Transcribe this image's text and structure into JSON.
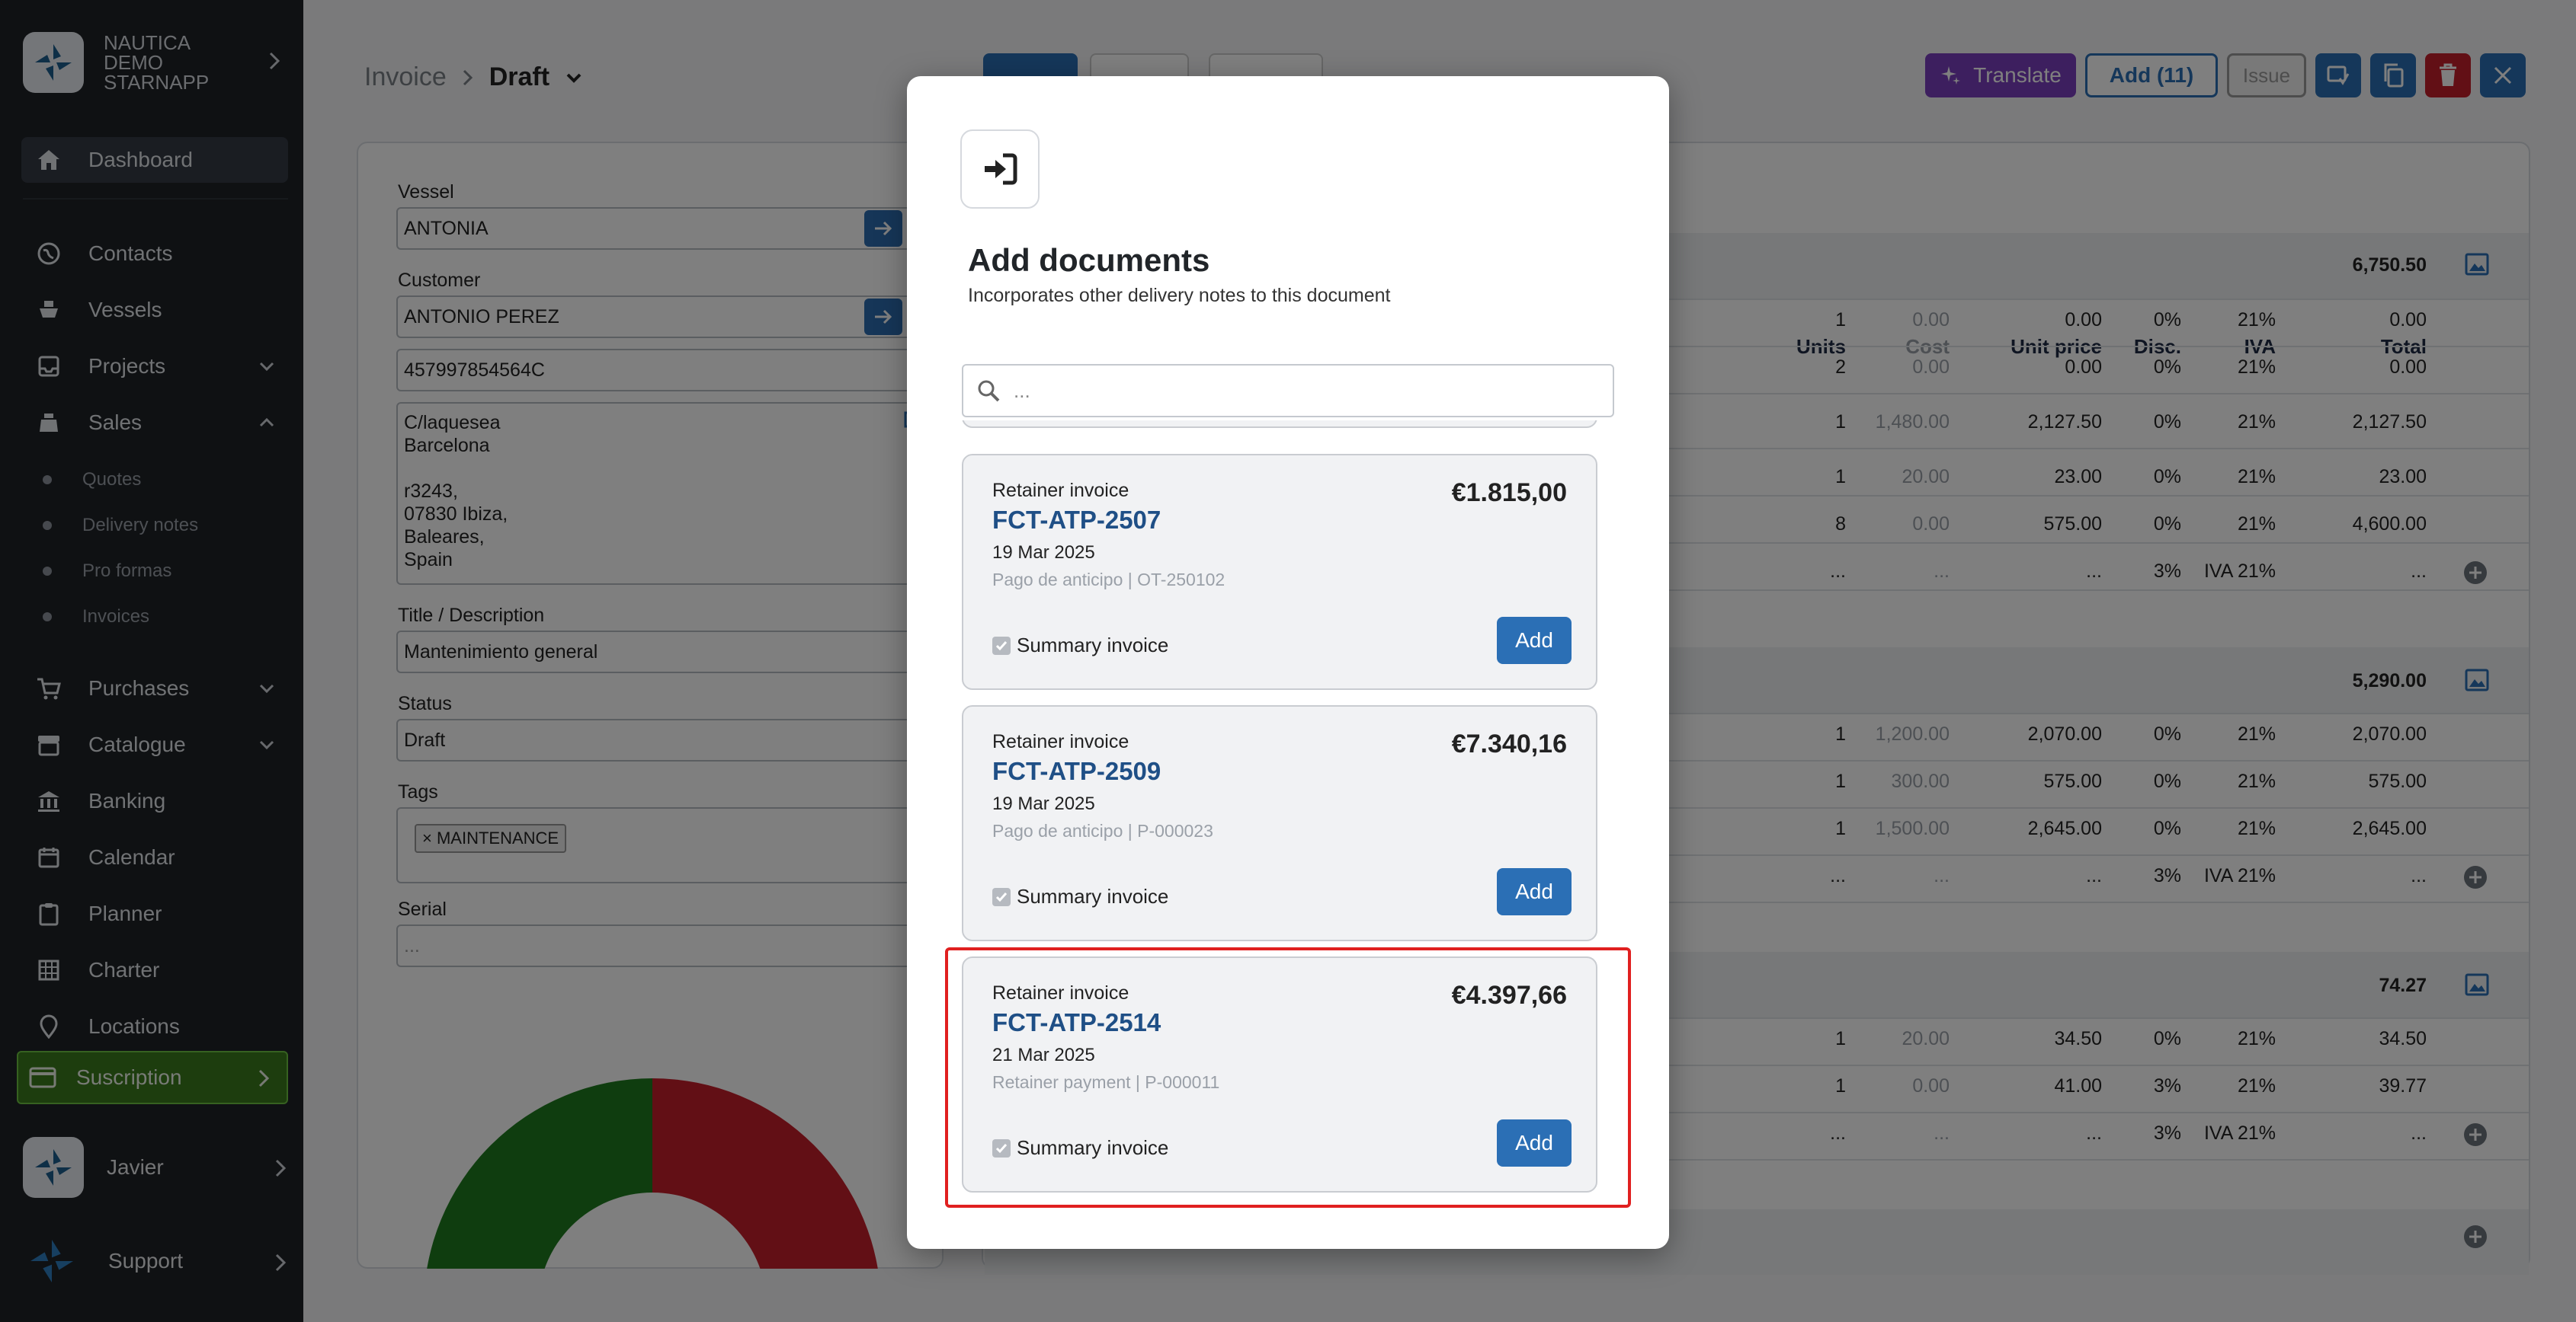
{
  "sidebar": {
    "org_name": "NAUTICA DEMO STARNAPP",
    "items": [
      {
        "label": "Dashboard",
        "icon": "home-icon"
      },
      {
        "label": "Contacts",
        "icon": "globe-icon"
      },
      {
        "label": "Vessels",
        "icon": "ship-icon"
      },
      {
        "label": "Projects",
        "icon": "inbox-icon"
      },
      {
        "label": "Sales",
        "icon": "cash-register-icon"
      },
      {
        "label": "Purchases",
        "icon": "cart-icon"
      },
      {
        "label": "Catalogue",
        "icon": "archive-icon"
      },
      {
        "label": "Banking",
        "icon": "bank-icon"
      },
      {
        "label": "Calendar",
        "icon": "calendar-icon"
      },
      {
        "label": "Planner",
        "icon": "clipboard-icon"
      },
      {
        "label": "Charter",
        "icon": "grid-icon"
      },
      {
        "label": "Locations",
        "icon": "location-icon"
      }
    ],
    "sales_sub": [
      "Quotes",
      "Delivery notes",
      "Pro formas",
      "Invoices"
    ],
    "subscription": "Suscription",
    "user": "Javier",
    "support": "Support"
  },
  "header": {
    "breadcrumb": [
      "Invoice",
      "Draft"
    ],
    "translate": "Translate",
    "add": "Add (11)",
    "issue": "Issue"
  },
  "form": {
    "vessel_label": "Vessel",
    "vessel": "ANTONIA",
    "customer_label": "Customer",
    "customer": "ANTONIO PEREZ",
    "tax_id": "457997854564C",
    "address": [
      "C/laquesea",
      "Barcelona",
      "",
      "r3243,",
      "07830 Ibiza,",
      "Baleares,",
      "Spain"
    ],
    "title_label": "Title / Description",
    "title": "Mantenimiento general",
    "status_label": "Status",
    "status": "Draft",
    "tags_label": "Tags",
    "tag": "MAINTENANCE",
    "serial_label": "Serial",
    "serial": "..."
  },
  "table": {
    "headers": [
      "Units",
      "Cost",
      "Unit price",
      "Disc.",
      "IVA",
      "Total"
    ],
    "group_totals": [
      "6,750.50",
      "5,290.00",
      "74.27"
    ],
    "rows": [
      [
        "1",
        "0.00",
        "0.00",
        "0%",
        "21%",
        "0.00"
      ],
      [
        "2",
        "0.00",
        "0.00",
        "0%",
        "21%",
        "0.00"
      ],
      [
        "1",
        "1,480.00",
        "2,127.50",
        "0%",
        "21%",
        "2,127.50"
      ],
      [
        "1",
        "20.00",
        "23.00",
        "0%",
        "21%",
        "23.00"
      ],
      [
        "8",
        "0.00",
        "575.00",
        "0%",
        "21%",
        "4,600.00"
      ],
      [
        "...",
        "...",
        "...",
        "3%",
        "IVA 21%",
        "..."
      ],
      [
        "1",
        "1,200.00",
        "2,070.00",
        "0%",
        "21%",
        "2,070.00"
      ],
      [
        "1",
        "300.00",
        "575.00",
        "0%",
        "21%",
        "575.00"
      ],
      [
        "1",
        "1,500.00",
        "2,645.00",
        "0%",
        "21%",
        "2,645.00"
      ],
      [
        "...",
        "...",
        "...",
        "3%",
        "IVA 21%",
        "..."
      ],
      [
        "1",
        "20.00",
        "34.50",
        "0%",
        "21%",
        "34.50"
      ],
      [
        "1",
        "0.00",
        "41.00",
        "3%",
        "21%",
        "39.77"
      ],
      [
        "...",
        "...",
        "...",
        "3%",
        "IVA 21%",
        "..."
      ]
    ]
  },
  "modal": {
    "title": "Add documents",
    "subtitle": "Incorporates other delivery notes to this document",
    "search_placeholder": "...",
    "documents": [
      {
        "type": "Retainer invoice",
        "number": "FCT-ATP-2507",
        "amount": "€1.815,00",
        "date": "19 Mar 2025",
        "ref": "Pago de anticipo | OT-250102",
        "summary": "Summary invoice",
        "add": "Add"
      },
      {
        "type": "Retainer invoice",
        "number": "FCT-ATP-2509",
        "amount": "€7.340,16",
        "date": "19 Mar 2025",
        "ref": "Pago de anticipo | P-000023",
        "summary": "Summary invoice",
        "add": "Add"
      },
      {
        "type": "Retainer invoice",
        "number": "FCT-ATP-2514",
        "amount": "€4.397,66",
        "date": "21 Mar 2025",
        "ref": "Retainer payment | P-000011",
        "summary": "Summary invoice",
        "add": "Add"
      }
    ]
  },
  "colors": {
    "accent": "#2b6fb5",
    "subscription": "#3a7a1c",
    "highlight": "#e02020",
    "translate": "#7b3fbf",
    "delete": "#c41e2a"
  }
}
